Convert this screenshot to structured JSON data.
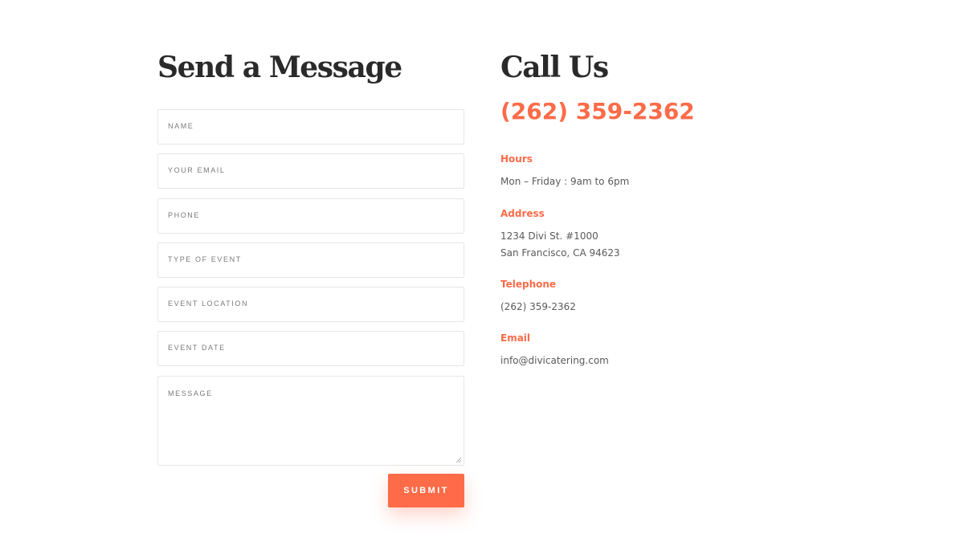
{
  "form": {
    "heading": "Send a Message",
    "fields": [
      {
        "label": "NAME"
      },
      {
        "label": "YOUR EMAIL"
      },
      {
        "label": "PHONE"
      },
      {
        "label": "TYPE OF EVENT"
      },
      {
        "label": "EVENT LOCATION"
      },
      {
        "label": "EVENT DATE"
      },
      {
        "label": "MESSAGE"
      }
    ],
    "submit_label": "SUBMIT"
  },
  "contact": {
    "heading": "Call Us",
    "phone": "(262) 359-2362",
    "hours": {
      "title": "Hours",
      "lines": [
        "Mon – Friday : 9am to 6pm"
      ]
    },
    "address": {
      "title": "Address",
      "lines": [
        "1234 Divi St. #1000",
        "San Francisco, CA 94623"
      ]
    },
    "telephone": {
      "title": "Telephone",
      "lines": [
        "(262) 359-2362"
      ]
    },
    "email": {
      "title": "Email",
      "lines": [
        "info@divicatering.com"
      ]
    }
  },
  "colors": {
    "accent": "#fd6b48",
    "heading": "#2a2a2a",
    "border": "#e6e6e6"
  }
}
